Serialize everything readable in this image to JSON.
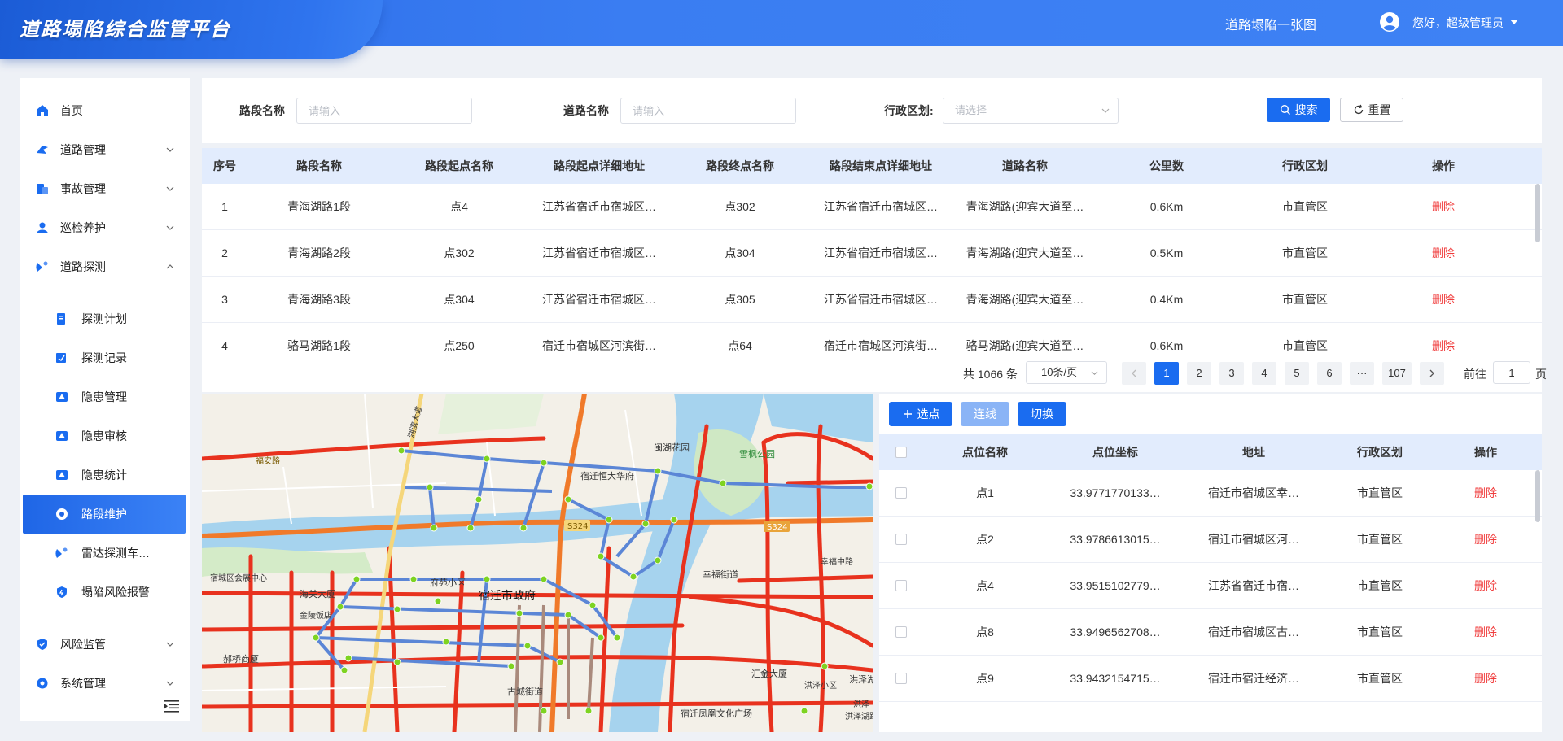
{
  "header": {
    "title": "道路塌陷综合监管平台",
    "overview_link": "道路塌陷一张图",
    "user_greeting": "您好，超级管理员"
  },
  "sidebar": {
    "items": [
      {
        "label": "首页",
        "icon": "home-icon"
      },
      {
        "label": "道路管理",
        "icon": "road-icon"
      },
      {
        "label": "事故管理",
        "icon": "accident-icon"
      },
      {
        "label": "巡检养护",
        "icon": "inspector-icon"
      },
      {
        "label": "道路探测",
        "icon": "radar-icon"
      },
      {
        "label": "探测计划",
        "icon": "plan-icon"
      },
      {
        "label": "探测记录",
        "icon": "record-icon"
      },
      {
        "label": "隐患管理",
        "icon": "warning-icon"
      },
      {
        "label": "隐患审核",
        "icon": "warning-icon"
      },
      {
        "label": "隐患统计",
        "icon": "warning-icon"
      },
      {
        "label": "路段维护",
        "icon": "segment-icon"
      },
      {
        "label": "雷达探测车…",
        "icon": "radar-car-icon"
      },
      {
        "label": "塌陷风险报警",
        "icon": "shield-icon"
      },
      {
        "label": "风险监管",
        "icon": "shield-check-icon"
      },
      {
        "label": "系统管理",
        "icon": "gear-icon"
      }
    ]
  },
  "search": {
    "segment_label": "路段名称",
    "segment_placeholder": "请输入",
    "road_label": "道路名称",
    "road_placeholder": "请输入",
    "district_label": "行政区划:",
    "district_placeholder": "请选择",
    "search_button": "搜索",
    "reset_button": "重置"
  },
  "segments_table": {
    "columns": [
      "序号",
      "路段名称",
      "路段起点名称",
      "路段起点详细地址",
      "路段终点名称",
      "路段结束点详细地址",
      "道路名称",
      "公里数",
      "行政区划",
      "操作"
    ],
    "rows": [
      {
        "no": "1",
        "name": "青海湖路1段",
        "start": "点4",
        "start_addr": "江苏省宿迁市宿城区…",
        "end": "点302",
        "end_addr": "江苏省宿迁市宿城区…",
        "road": "青海湖路(迎宾大道至…",
        "km": "0.6Km",
        "district": "市直管区",
        "action": "删除"
      },
      {
        "no": "2",
        "name": "青海湖路2段",
        "start": "点302",
        "start_addr": "江苏省宿迁市宿城区…",
        "end": "点304",
        "end_addr": "江苏省宿迁市宿城区…",
        "road": "青海湖路(迎宾大道至…",
        "km": "0.5Km",
        "district": "市直管区",
        "action": "删除"
      },
      {
        "no": "3",
        "name": "青海湖路3段",
        "start": "点304",
        "start_addr": "江苏省宿迁市宿城区…",
        "end": "点305",
        "end_addr": "江苏省宿迁市宿城区…",
        "road": "青海湖路(迎宾大道至…",
        "km": "0.4Km",
        "district": "市直管区",
        "action": "删除"
      },
      {
        "no": "4",
        "name": "骆马湖路1段",
        "start": "点250",
        "start_addr": "宿迁市宿城区河滨街…",
        "end": "点64",
        "end_addr": "宿迁市宿城区河滨街…",
        "road": "骆马湖路(迎宾大道至…",
        "km": "0.6Km",
        "district": "市直管区",
        "action": "删除"
      }
    ]
  },
  "pagination": {
    "total": "共 1066 条",
    "page_size": "10条/页",
    "pages": [
      "1",
      "2",
      "3",
      "4",
      "5",
      "6",
      "···",
      "107"
    ],
    "current": "1",
    "goto_label": "前往",
    "goto_value": "1",
    "page_suffix": "页"
  },
  "map": {
    "labels": [
      "宿迁市政府",
      "宿迁恒大华府",
      "闽湖花园",
      "雪枫公园",
      "幸福街道",
      "S324",
      "府苑小区",
      "海关大厦",
      "古城街道",
      "汇金大厦",
      "洪泽湖",
      "宿迁凤凰文化广场",
      "S324",
      "湖滨大道",
      "福安路",
      "幸福中路",
      "郝桥商厦",
      "宿城区会展中心",
      "金陵饭店",
      "洪泽湖路",
      "洪泽",
      "洪泽小区"
    ]
  },
  "points": {
    "add_button": "选点",
    "connect_button": "连线",
    "switch_button": "切换",
    "columns": [
      "点位名称",
      "点位坐标",
      "地址",
      "行政区划",
      "操作"
    ],
    "rows": [
      {
        "name": "点1",
        "coord": "33.9771770133…",
        "addr": "宿迁市宿城区幸…",
        "district": "市直管区",
        "action": "删除"
      },
      {
        "name": "点2",
        "coord": "33.9786613015…",
        "addr": "宿迁市宿城区河…",
        "district": "市直管区",
        "action": "删除"
      },
      {
        "name": "点4",
        "coord": "33.9515102779…",
        "addr": "江苏省宿迁市宿…",
        "district": "市直管区",
        "action": "删除"
      },
      {
        "name": "点8",
        "coord": "33.9496562708…",
        "addr": "宿迁市宿城区古…",
        "district": "市直管区",
        "action": "删除"
      },
      {
        "name": "点9",
        "coord": "33.9432154715…",
        "addr": "宿迁市宿迁经济…",
        "district": "市直管区",
        "action": "删除"
      }
    ]
  },
  "colors": {
    "primary": "#1a6cf0",
    "danger": "#f03c3c",
    "header": "#3a7df2",
    "road_major": "#e8321e",
    "road_route": "#5b86d6",
    "route_node": "#7ed321"
  }
}
